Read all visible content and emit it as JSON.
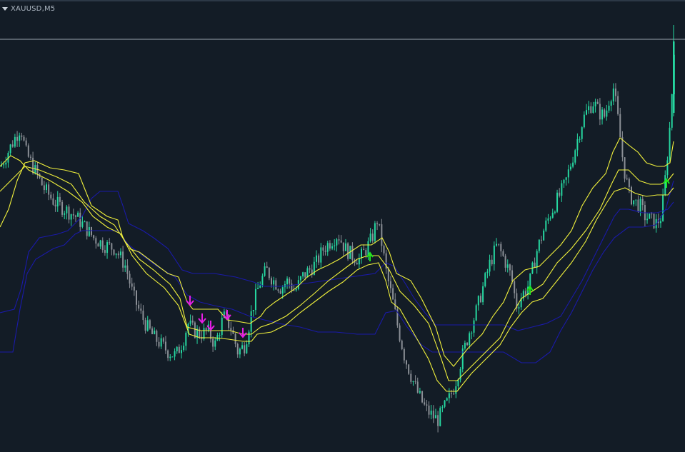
{
  "window": {
    "symbol_label": "XAUUSD,M5"
  },
  "colors": {
    "background": "#131c26",
    "bull_candle": "#26d7a0",
    "bear_candle": "#8b8f96",
    "yellow_band": "#f2f23c",
    "blue_band": "#1a1aa8",
    "sell_arrow": "#e61ee6",
    "buy_arrow": "#1ee61e",
    "price_line": "#9aa4ae"
  },
  "chart_data": {
    "type": "candlestick",
    "title": "",
    "xlabel": "",
    "ylabel": "",
    "ylim": [
      0,
      633
    ],
    "price_line_level": 578,
    "close_path": [
      [
        0,
        400
      ],
      [
        10,
        420
      ],
      [
        20,
        440
      ],
      [
        28,
        455
      ],
      [
        35,
        420
      ],
      [
        45,
        400
      ],
      [
        60,
        370
      ],
      [
        75,
        350
      ],
      [
        90,
        340
      ],
      [
        105,
        330
      ],
      [
        118,
        315
      ],
      [
        130,
        300
      ],
      [
        145,
        290
      ],
      [
        160,
        285
      ],
      [
        175,
        260
      ],
      [
        185,
        220
      ],
      [
        195,
        195
      ],
      [
        205,
        175
      ],
      [
        215,
        160
      ],
      [
        225,
        150
      ],
      [
        235,
        140
      ],
      [
        245,
        135
      ],
      [
        255,
        155
      ],
      [
        262,
        180
      ],
      [
        270,
        170
      ],
      [
        280,
        165
      ],
      [
        290,
        170
      ],
      [
        300,
        150
      ],
      [
        312,
        190
      ],
      [
        322,
        175
      ],
      [
        332,
        140
      ],
      [
        342,
        150
      ],
      [
        352,
        200
      ],
      [
        362,
        235
      ],
      [
        372,
        255
      ],
      [
        382,
        240
      ],
      [
        392,
        230
      ],
      [
        402,
        240
      ],
      [
        412,
        225
      ],
      [
        422,
        245
      ],
      [
        432,
        255
      ],
      [
        442,
        265
      ],
      [
        452,
        285
      ],
      [
        462,
        295
      ],
      [
        472,
        305
      ],
      [
        482,
        285
      ],
      [
        492,
        275
      ],
      [
        502,
        270
      ],
      [
        512,
        285
      ],
      [
        520,
        300
      ],
      [
        527,
        325
      ],
      [
        533,
        295
      ],
      [
        540,
        250
      ],
      [
        548,
        215
      ],
      [
        556,
        175
      ],
      [
        565,
        135
      ],
      [
        575,
        105
      ],
      [
        585,
        80
      ],
      [
        595,
        60
      ],
      [
        605,
        50
      ],
      [
        612,
        45
      ],
      [
        620,
        60
      ],
      [
        628,
        75
      ],
      [
        636,
        95
      ],
      [
        645,
        130
      ],
      [
        655,
        165
      ],
      [
        665,
        195
      ],
      [
        675,
        230
      ],
      [
        685,
        265
      ],
      [
        695,
        290
      ],
      [
        705,
        270
      ],
      [
        715,
        245
      ],
      [
        722,
        205
      ],
      [
        730,
        220
      ],
      [
        740,
        235
      ],
      [
        750,
        280
      ],
      [
        760,
        310
      ],
      [
        770,
        335
      ],
      [
        780,
        355
      ],
      [
        790,
        375
      ],
      [
        800,
        410
      ],
      [
        808,
        440
      ],
      [
        815,
        465
      ],
      [
        822,
        480
      ],
      [
        830,
        490
      ],
      [
        838,
        475
      ],
      [
        846,
        470
      ],
      [
        852,
        495
      ],
      [
        858,
        510
      ],
      [
        865,
        460
      ],
      [
        872,
        400
      ],
      [
        880,
        360
      ],
      [
        888,
        350
      ],
      [
        895,
        345
      ],
      [
        902,
        330
      ],
      [
        910,
        325
      ],
      [
        918,
        320
      ],
      [
        925,
        330
      ],
      [
        932,
        400
      ],
      [
        938,
        470
      ],
      [
        943,
        570
      ]
    ],
    "yellow_upper": [
      [
        0,
        315
      ],
      [
        12,
        340
      ],
      [
        24,
        380
      ],
      [
        35,
        405
      ],
      [
        48,
        408
      ],
      [
        70,
        398
      ],
      [
        90,
        395
      ],
      [
        110,
        390
      ],
      [
        118,
        370
      ],
      [
        128,
        345
      ],
      [
        150,
        330
      ],
      [
        165,
        325
      ],
      [
        172,
        300
      ],
      [
        180,
        285
      ],
      [
        195,
        280
      ],
      [
        215,
        265
      ],
      [
        235,
        250
      ],
      [
        250,
        245
      ],
      [
        262,
        210
      ],
      [
        270,
        200
      ],
      [
        285,
        200
      ],
      [
        305,
        200
      ],
      [
        318,
        185
      ],
      [
        332,
        183
      ],
      [
        350,
        180
      ],
      [
        365,
        190
      ],
      [
        372,
        200
      ],
      [
        385,
        210
      ],
      [
        400,
        220
      ],
      [
        415,
        230
      ],
      [
        430,
        245
      ],
      [
        445,
        255
      ],
      [
        460,
        262
      ],
      [
        475,
        270
      ],
      [
        490,
        280
      ],
      [
        505,
        290
      ],
      [
        520,
        290
      ],
      [
        535,
        300
      ],
      [
        545,
        280
      ],
      [
        555,
        250
      ],
      [
        575,
        240
      ],
      [
        590,
        215
      ],
      [
        610,
        175
      ],
      [
        622,
        135
      ],
      [
        635,
        120
      ],
      [
        655,
        145
      ],
      [
        675,
        165
      ],
      [
        690,
        190
      ],
      [
        705,
        210
      ],
      [
        718,
        240
      ],
      [
        735,
        255
      ],
      [
        755,
        260
      ],
      [
        770,
        275
      ],
      [
        785,
        290
      ],
      [
        800,
        310
      ],
      [
        815,
        345
      ],
      [
        830,
        370
      ],
      [
        848,
        390
      ],
      [
        858,
        420
      ],
      [
        868,
        440
      ],
      [
        880,
        430
      ],
      [
        893,
        420
      ],
      [
        905,
        405
      ],
      [
        920,
        400
      ],
      [
        930,
        400
      ],
      [
        938,
        405
      ],
      [
        943,
        435
      ]
    ],
    "yellow_mid": [
      [
        0,
        365
      ],
      [
        20,
        385
      ],
      [
        35,
        400
      ],
      [
        55,
        395
      ],
      [
        80,
        385
      ],
      [
        100,
        375
      ],
      [
        118,
        350
      ],
      [
        140,
        330
      ],
      [
        160,
        318
      ],
      [
        175,
        295
      ],
      [
        195,
        270
      ],
      [
        215,
        255
      ],
      [
        238,
        235
      ],
      [
        252,
        215
      ],
      [
        262,
        175
      ],
      [
        280,
        170
      ],
      [
        300,
        170
      ],
      [
        322,
        170
      ],
      [
        340,
        165
      ],
      [
        352,
        165
      ],
      [
        365,
        175
      ],
      [
        380,
        180
      ],
      [
        400,
        190
      ],
      [
        420,
        205
      ],
      [
        440,
        222
      ],
      [
        460,
        240
      ],
      [
        480,
        255
      ],
      [
        500,
        270
      ],
      [
        515,
        275
      ],
      [
        530,
        275
      ],
      [
        545,
        255
      ],
      [
        560,
        225
      ],
      [
        580,
        205
      ],
      [
        600,
        180
      ],
      [
        618,
        130
      ],
      [
        628,
        100
      ],
      [
        640,
        100
      ],
      [
        660,
        120
      ],
      [
        680,
        140
      ],
      [
        700,
        160
      ],
      [
        715,
        190
      ],
      [
        730,
        215
      ],
      [
        745,
        225
      ],
      [
        760,
        235
      ],
      [
        780,
        265
      ],
      [
        800,
        285
      ],
      [
        820,
        310
      ],
      [
        840,
        340
      ],
      [
        856,
        375
      ],
      [
        866,
        395
      ],
      [
        880,
        395
      ],
      [
        895,
        380
      ],
      [
        910,
        375
      ],
      [
        925,
        375
      ],
      [
        935,
        380
      ],
      [
        943,
        390
      ]
    ],
    "yellow_lower": [
      [
        0,
        400
      ],
      [
        15,
        415
      ],
      [
        28,
        408
      ],
      [
        40,
        395
      ],
      [
        70,
        380
      ],
      [
        95,
        365
      ],
      [
        115,
        350
      ],
      [
        130,
        330
      ],
      [
        150,
        315
      ],
      [
        170,
        305
      ],
      [
        185,
        275
      ],
      [
        205,
        250
      ],
      [
        230,
        230
      ],
      [
        250,
        205
      ],
      [
        265,
        165
      ],
      [
        280,
        160
      ],
      [
        300,
        160
      ],
      [
        320,
        158
      ],
      [
        340,
        155
      ],
      [
        352,
        155
      ],
      [
        360,
        165
      ],
      [
        380,
        168
      ],
      [
        400,
        178
      ],
      [
        420,
        195
      ],
      [
        440,
        210
      ],
      [
        460,
        225
      ],
      [
        480,
        238
      ],
      [
        500,
        255
      ],
      [
        515,
        262
      ],
      [
        530,
        265
      ],
      [
        540,
        240
      ],
      [
        548,
        210
      ],
      [
        560,
        200
      ],
      [
        580,
        165
      ],
      [
        600,
        130
      ],
      [
        612,
        100
      ],
      [
        625,
        85
      ],
      [
        640,
        85
      ],
      [
        660,
        110
      ],
      [
        680,
        130
      ],
      [
        700,
        150
      ],
      [
        715,
        175
      ],
      [
        730,
        195
      ],
      [
        745,
        210
      ],
      [
        760,
        215
      ],
      [
        780,
        240
      ],
      [
        800,
        265
      ],
      [
        820,
        295
      ],
      [
        835,
        325
      ],
      [
        850,
        350
      ],
      [
        860,
        365
      ],
      [
        875,
        370
      ],
      [
        890,
        362
      ],
      [
        905,
        358
      ],
      [
        920,
        360
      ],
      [
        935,
        360
      ],
      [
        943,
        370
      ]
    ],
    "blue_upper": [
      [
        0,
        195
      ],
      [
        20,
        200
      ],
      [
        30,
        230
      ],
      [
        40,
        280
      ],
      [
        55,
        300
      ],
      [
        80,
        305
      ],
      [
        95,
        310
      ],
      [
        115,
        330
      ],
      [
        128,
        355
      ],
      [
        140,
        365
      ],
      [
        165,
        365
      ],
      [
        172,
        345
      ],
      [
        180,
        320
      ],
      [
        200,
        310
      ],
      [
        215,
        300
      ],
      [
        235,
        285
      ],
      [
        255,
        255
      ],
      [
        270,
        250
      ],
      [
        300,
        250
      ],
      [
        330,
        245
      ],
      [
        355,
        238
      ],
      [
        370,
        232
      ],
      [
        395,
        232
      ],
      [
        420,
        235
      ],
      [
        455,
        240
      ],
      [
        490,
        245
      ],
      [
        525,
        250
      ],
      [
        540,
        265
      ],
      [
        552,
        260
      ],
      [
        568,
        235
      ],
      [
        580,
        215
      ],
      [
        595,
        195
      ],
      [
        610,
        178
      ],
      [
        640,
        178
      ],
      [
        680,
        178
      ],
      [
        705,
        178
      ],
      [
        725,
        170
      ],
      [
        745,
        175
      ],
      [
        765,
        180
      ],
      [
        785,
        190
      ],
      [
        800,
        215
      ],
      [
        815,
        240
      ],
      [
        830,
        270
      ],
      [
        845,
        300
      ],
      [
        860,
        330
      ],
      [
        868,
        340
      ],
      [
        880,
        340
      ],
      [
        900,
        335
      ],
      [
        920,
        335
      ],
      [
        935,
        340
      ],
      [
        943,
        350
      ]
    ],
    "blue_lower": [
      [
        0,
        140
      ],
      [
        18,
        140
      ],
      [
        28,
        200
      ],
      [
        38,
        250
      ],
      [
        50,
        270
      ],
      [
        75,
        285
      ],
      [
        90,
        290
      ],
      [
        105,
        305
      ],
      [
        115,
        310
      ],
      [
        140,
        310
      ],
      [
        165,
        310
      ],
      [
        180,
        290
      ],
      [
        200,
        275
      ],
      [
        220,
        260
      ],
      [
        245,
        245
      ],
      [
        262,
        220
      ],
      [
        280,
        210
      ],
      [
        300,
        205
      ],
      [
        325,
        200
      ],
      [
        350,
        190
      ],
      [
        370,
        185
      ],
      [
        390,
        180
      ],
      [
        420,
        175
      ],
      [
        445,
        168
      ],
      [
        470,
        168
      ],
      [
        500,
        165
      ],
      [
        525,
        165
      ],
      [
        540,
        195
      ],
      [
        555,
        198
      ],
      [
        570,
        175
      ],
      [
        590,
        150
      ],
      [
        605,
        140
      ],
      [
        640,
        140
      ],
      [
        680,
        140
      ],
      [
        705,
        140
      ],
      [
        730,
        125
      ],
      [
        750,
        125
      ],
      [
        770,
        140
      ],
      [
        785,
        170
      ],
      [
        800,
        195
      ],
      [
        815,
        225
      ],
      [
        830,
        255
      ],
      [
        845,
        280
      ],
      [
        860,
        300
      ],
      [
        880,
        315
      ],
      [
        900,
        315
      ],
      [
        918,
        318
      ],
      [
        932,
        340
      ],
      [
        943,
        380
      ]
    ],
    "sell_arrows": [
      {
        "x": 266,
        "y": 210
      },
      {
        "x": 283,
        "y": 185
      },
      {
        "x": 295,
        "y": 175
      },
      {
        "x": 318,
        "y": 190
      },
      {
        "x": 340,
        "y": 165
      }
    ],
    "buy_arrows": [
      {
        "x": 518,
        "y": 275
      },
      {
        "x": 742,
        "y": 228
      },
      {
        "x": 933,
        "y": 378
      }
    ]
  }
}
